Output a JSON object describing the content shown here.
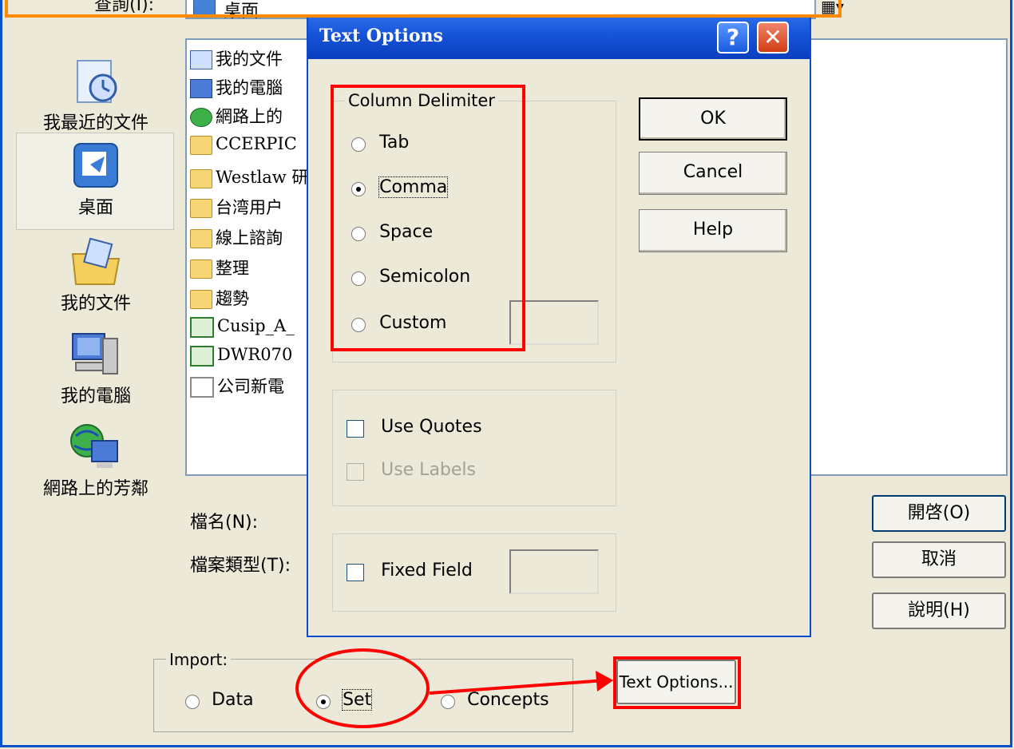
{
  "outer_dialog": {
    "lookin_label": "查詢(I):",
    "lookin_value": "桌面",
    "places": [
      {
        "label": "我最近的文件",
        "icon": "recent-documents-icon"
      },
      {
        "label": "桌面",
        "icon": "desktop-icon"
      },
      {
        "label": "我的文件",
        "icon": "my-documents-icon"
      },
      {
        "label": "我的電腦",
        "icon": "my-computer-icon"
      },
      {
        "label": "網路上的芳鄰",
        "icon": "network-places-icon"
      }
    ],
    "files": [
      {
        "name": "我的文件",
        "icon": "mydoc"
      },
      {
        "name": "我的電腦",
        "icon": "pc"
      },
      {
        "name": "網路上的",
        "icon": "net"
      },
      {
        "name": "CCERPIC",
        "icon": "folder"
      },
      {
        "name": "Westlaw 研",
        "icon": "folder"
      },
      {
        "name": "台湾用户",
        "icon": "folder"
      },
      {
        "name": "線上諮詢",
        "icon": "folder"
      },
      {
        "name": "整理",
        "icon": "folder"
      },
      {
        "name": "趨勢",
        "icon": "folder"
      },
      {
        "name": "Cusip_A_",
        "icon": "xls"
      },
      {
        "name": "DWR070",
        "icon": "xls"
      },
      {
        "name": "公司新電",
        "icon": "doc"
      }
    ],
    "filename_label": "檔名(N):",
    "filetype_label": "檔案類型(T):",
    "open_button": "開啓(O)",
    "cancel_button": "取消",
    "help_button": "說明(H)",
    "import": {
      "legend": "Import:",
      "options": [
        "Data",
        "Set",
        "Concepts"
      ],
      "selected": "Set"
    },
    "text_options_button": "Text Options..."
  },
  "text_options_dialog": {
    "title": "Text Options",
    "help_glyph": "?",
    "close_glyph": "✕",
    "column_delimiter": {
      "legend": "Column Delimiter",
      "options": [
        "Tab",
        "Comma",
        "Space",
        "Semicolon",
        "Custom"
      ],
      "selected": "Comma",
      "custom_value": ""
    },
    "ok_button": "OK",
    "cancel_button": "Cancel",
    "help_button": "Help",
    "use_quotes": {
      "label": "Use Quotes",
      "checked": false
    },
    "use_labels": {
      "label": "Use Labels",
      "checked": false,
      "disabled": true
    },
    "fixed_field": {
      "label": "Fixed Field",
      "checked": false,
      "value": ""
    }
  },
  "colors": {
    "annotation_red": "#ff0000",
    "callout_orange": "#ff8a00",
    "title_blue": "#1552d6"
  }
}
